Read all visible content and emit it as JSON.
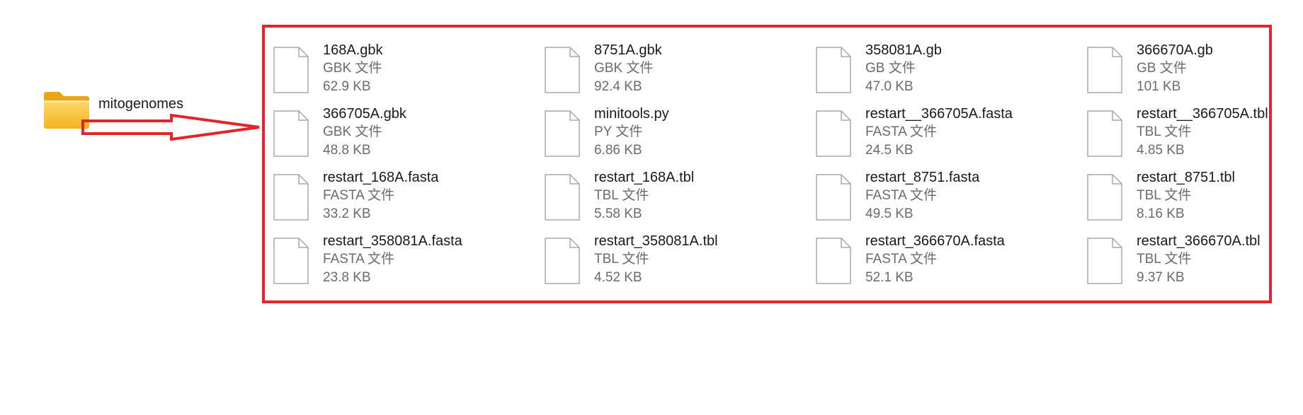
{
  "folder": {
    "label": "mitogenomes",
    "icon": "folder-icon"
  },
  "arrow_color": "#e3242b",
  "frame_color": "#e3242b",
  "files": [
    {
      "name": "168A.gbk",
      "type": "GBK 文件",
      "size": "62.9 KB"
    },
    {
      "name": "8751A.gbk",
      "type": "GBK 文件",
      "size": "92.4 KB"
    },
    {
      "name": "358081A.gb",
      "type": "GB 文件",
      "size": "47.0 KB"
    },
    {
      "name": "366670A.gb",
      "type": "GB 文件",
      "size": "101 KB"
    },
    {
      "name": "366705A.gbk",
      "type": "GBK 文件",
      "size": "48.8 KB"
    },
    {
      "name": "minitools.py",
      "type": "PY 文件",
      "size": "6.86 KB"
    },
    {
      "name": "restart__366705A.fasta",
      "type": "FASTA 文件",
      "size": "24.5 KB"
    },
    {
      "name": "restart__366705A.tbl",
      "type": "TBL 文件",
      "size": "4.85 KB"
    },
    {
      "name": "restart_168A.fasta",
      "type": "FASTA 文件",
      "size": "33.2 KB"
    },
    {
      "name": "restart_168A.tbl",
      "type": "TBL 文件",
      "size": "5.58 KB"
    },
    {
      "name": "restart_8751.fasta",
      "type": "FASTA 文件",
      "size": "49.5 KB"
    },
    {
      "name": "restart_8751.tbl",
      "type": "TBL 文件",
      "size": "8.16 KB"
    },
    {
      "name": "restart_358081A.fasta",
      "type": "FASTA 文件",
      "size": "23.8 KB"
    },
    {
      "name": "restart_358081A.tbl",
      "type": "TBL 文件",
      "size": "4.52 KB"
    },
    {
      "name": "restart_366670A.fasta",
      "type": "FASTA 文件",
      "size": "52.1 KB"
    },
    {
      "name": "restart_366670A.tbl",
      "type": "TBL 文件",
      "size": "9.37 KB"
    }
  ]
}
